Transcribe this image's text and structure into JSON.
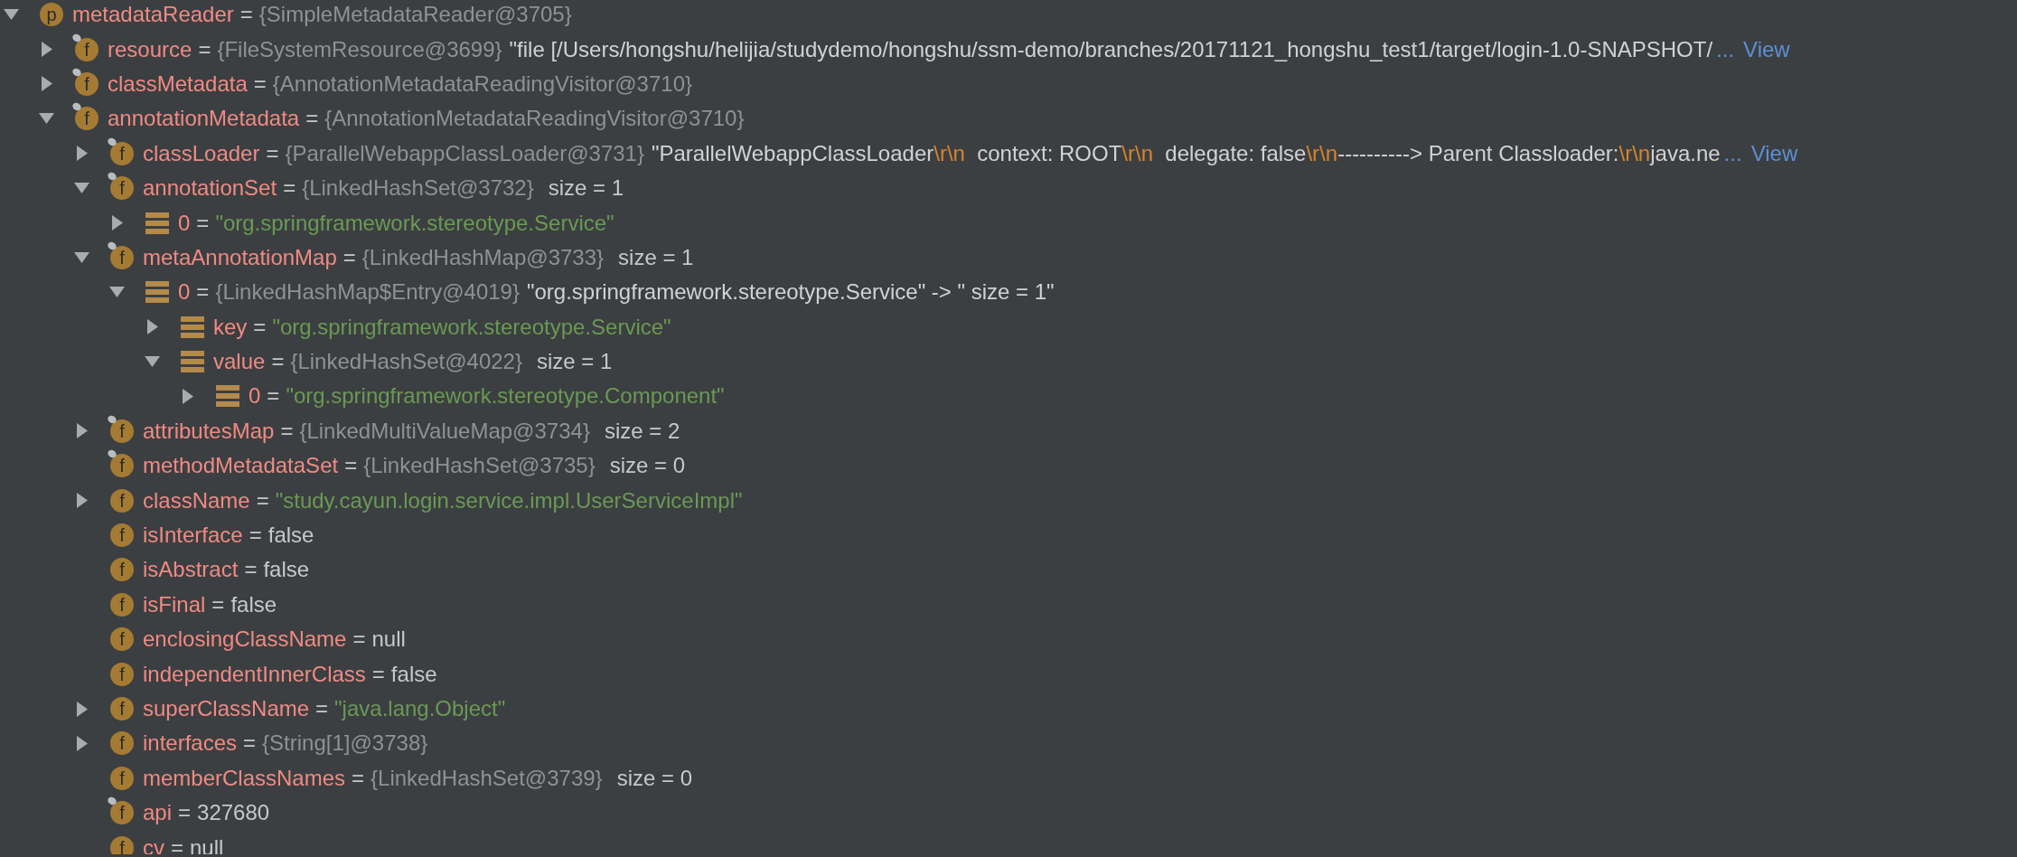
{
  "variables": [
    {
      "name": "metadataReader",
      "sep": "=",
      "ref": "{SimpleMetadataReader@3705}",
      "kind": "field",
      "badge": "p",
      "pinned": false,
      "expandable": true,
      "expanded": true,
      "children": [
        {
          "name": "resource",
          "sep": "=",
          "ref": "{FileSystemResource@3699}",
          "kind": "field",
          "badge": "f",
          "pinned": true,
          "expandable": true,
          "expanded": false,
          "parts": [
            {
              "text": "\"file [/Users/hongshu/helijia/studydemo/hongshu/ssm-demo/branches/20171121_hongshu_test1/target/login-1.0-SNAPSHOT/",
              "escape": false
            }
          ],
          "ellipsis": "...",
          "link": "View"
        },
        {
          "name": "classMetadata",
          "sep": "=",
          "ref": "{AnnotationMetadataReadingVisitor@3710}",
          "kind": "field",
          "badge": "f",
          "pinned": true,
          "expandable": true,
          "expanded": false
        },
        {
          "name": "annotationMetadata",
          "sep": "=",
          "ref": "{AnnotationMetadataReadingVisitor@3710}",
          "kind": "field",
          "badge": "f",
          "pinned": true,
          "expandable": true,
          "expanded": true,
          "children": [
            {
              "name": "classLoader",
              "sep": "=",
              "ref": "{ParallelWebappClassLoader@3731}",
              "kind": "field",
              "badge": "f",
              "pinned": true,
              "expandable": true,
              "expanded": false,
              "parts": [
                {
                  "text": "\"ParallelWebappClassLoader",
                  "escape": false
                },
                {
                  "text": "\\r\\n",
                  "escape": true
                },
                {
                  "text": "  context: ROOT",
                  "escape": false
                },
                {
                  "text": "\\r\\n",
                  "escape": true
                },
                {
                  "text": "  delegate: false",
                  "escape": false
                },
                {
                  "text": "\\r\\n",
                  "escape": true
                },
                {
                  "text": "----------> Parent Classloader:",
                  "escape": false
                },
                {
                  "text": "\\r\\n",
                  "escape": true
                },
                {
                  "text": "java.ne",
                  "escape": false
                }
              ],
              "ellipsis": "...",
              "link": "View"
            },
            {
              "name": "annotationSet",
              "sep": "=",
              "ref": "{LinkedHashSet@3732}",
              "size": "size = 1",
              "kind": "field",
              "badge": "f",
              "pinned": true,
              "expandable": true,
              "expanded": true,
              "children": [
                {
                  "name": "0",
                  "sep": "=",
                  "value": "\"org.springframework.stereotype.Service\"",
                  "string": true,
                  "kind": "entry",
                  "expandable": true,
                  "expanded": false
                }
              ]
            },
            {
              "name": "metaAnnotationMap",
              "sep": "=",
              "ref": "{LinkedHashMap@3733}",
              "size": "size = 1",
              "kind": "field",
              "badge": "f",
              "pinned": true,
              "expandable": true,
              "expanded": true,
              "children": [
                {
                  "name": "0",
                  "sep": "=",
                  "ref": "{LinkedHashMap$Entry@4019}",
                  "parts": [
                    {
                      "text": "\"org.springframework.stereotype.Service\" -> \" size = 1\"",
                      "escape": false
                    }
                  ],
                  "kind": "entry",
                  "expandable": true,
                  "expanded": true,
                  "children": [
                    {
                      "name": "key",
                      "sep": "=",
                      "value": "\"org.springframework.stereotype.Service\"",
                      "string": true,
                      "kind": "entry",
                      "expandable": true,
                      "expanded": false
                    },
                    {
                      "name": "value",
                      "sep": "=",
                      "ref": "{LinkedHashSet@4022}",
                      "size": "size = 1",
                      "kind": "entry",
                      "expandable": true,
                      "expanded": true,
                      "children": [
                        {
                          "name": "0",
                          "sep": "=",
                          "value": "\"org.springframework.stereotype.Component\"",
                          "string": true,
                          "kind": "entry",
                          "expandable": true,
                          "expanded": false
                        }
                      ]
                    }
                  ]
                }
              ]
            },
            {
              "name": "attributesMap",
              "sep": "=",
              "ref": "{LinkedMultiValueMap@3734}",
              "size": "size = 2",
              "kind": "field",
              "badge": "f",
              "pinned": true,
              "expandable": true,
              "expanded": false
            },
            {
              "name": "methodMetadataSet",
              "sep": "=",
              "ref": "{LinkedHashSet@3735}",
              "size": "size = 0",
              "kind": "field",
              "badge": "f",
              "pinned": true,
              "expandable": false
            },
            {
              "name": "className",
              "sep": "=",
              "value": "\"study.cayun.login.service.impl.UserServiceImpl\"",
              "string": true,
              "kind": "field",
              "badge": "f",
              "pinned": false,
              "expandable": true,
              "expanded": false
            },
            {
              "name": "isInterface",
              "sep": "=",
              "value": "false",
              "string": false,
              "kind": "field",
              "badge": "f",
              "pinned": false,
              "expandable": false
            },
            {
              "name": "isAbstract",
              "sep": "=",
              "value": "false",
              "string": false,
              "kind": "field",
              "badge": "f",
              "pinned": false,
              "expandable": false
            },
            {
              "name": "isFinal",
              "sep": "=",
              "value": "false",
              "string": false,
              "kind": "field",
              "badge": "f",
              "pinned": false,
              "expandable": false
            },
            {
              "name": "enclosingClassName",
              "sep": "=",
              "value": "null",
              "string": false,
              "kind": "field",
              "badge": "f",
              "pinned": false,
              "expandable": false
            },
            {
              "name": "independentInnerClass",
              "sep": "=",
              "value": "false",
              "string": false,
              "kind": "field",
              "badge": "f",
              "pinned": false,
              "expandable": false
            },
            {
              "name": "superClassName",
              "sep": "=",
              "value": "\"java.lang.Object\"",
              "string": true,
              "kind": "field",
              "badge": "f",
              "pinned": false,
              "expandable": true,
              "expanded": false
            },
            {
              "name": "interfaces",
              "sep": "=",
              "ref": "{String[1]@3738}",
              "kind": "field",
              "badge": "f",
              "pinned": false,
              "expandable": true,
              "expanded": false
            },
            {
              "name": "memberClassNames",
              "sep": "=",
              "ref": "{LinkedHashSet@3739}",
              "size": "size = 0",
              "kind": "field",
              "badge": "f",
              "pinned": false,
              "expandable": false
            },
            {
              "name": "api",
              "sep": "=",
              "value": "327680",
              "string": false,
              "kind": "field",
              "badge": "f",
              "pinned": true,
              "expandable": false
            },
            {
              "name": "cv",
              "sep": "=",
              "value": "null",
              "string": false,
              "kind": "field",
              "badge": "f",
              "pinned": false,
              "expandable": false
            }
          ]
        }
      ]
    }
  ]
}
